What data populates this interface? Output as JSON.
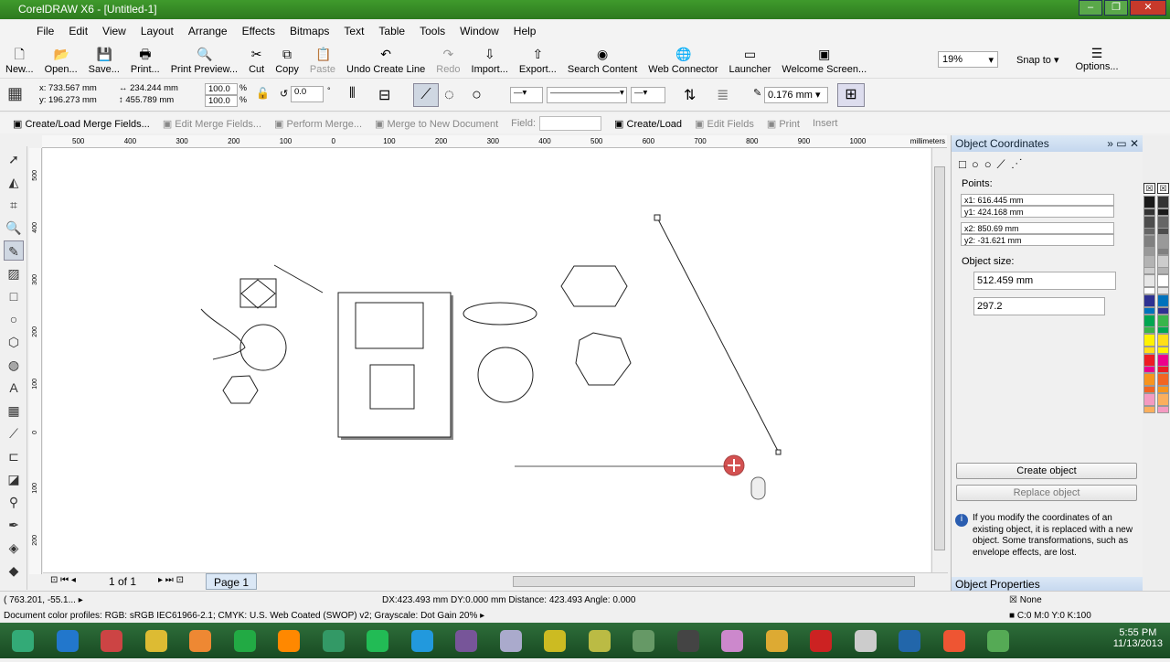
{
  "window": {
    "title": "CorelDRAW X6 - [Untitled-1]",
    "minimize": "–",
    "restore": "❐",
    "close": "✕"
  },
  "menu": [
    "File",
    "Edit",
    "View",
    "Layout",
    "Arrange",
    "Effects",
    "Bitmaps",
    "Text",
    "Table",
    "Tools",
    "Window",
    "Help"
  ],
  "toolbar": [
    {
      "label": "New...",
      "icon": "new-icon",
      "g": "🗋"
    },
    {
      "label": "Open...",
      "icon": "open-icon",
      "g": "📂"
    },
    {
      "label": "Save...",
      "icon": "save-icon",
      "g": "💾"
    },
    {
      "label": "Print...",
      "icon": "print-icon",
      "g": "🖶"
    },
    {
      "label": "Print Preview...",
      "icon": "print-preview-icon",
      "g": "🔍"
    },
    {
      "label": "Cut",
      "icon": "cut-icon",
      "g": "✂"
    },
    {
      "label": "Copy",
      "icon": "copy-icon",
      "g": "⧉"
    },
    {
      "label": "Paste",
      "icon": "paste-icon",
      "g": "📋",
      "disabled": true
    },
    {
      "label": "Undo Create Line",
      "icon": "undo-icon",
      "g": "↶"
    },
    {
      "label": "Redo",
      "icon": "redo-icon",
      "g": "↷",
      "disabled": true
    },
    {
      "label": "Import...",
      "icon": "import-icon",
      "g": "⇩"
    },
    {
      "label": "Export...",
      "icon": "export-icon",
      "g": "⇧"
    },
    {
      "label": "Search Content",
      "icon": "search-content-icon",
      "g": "◉"
    },
    {
      "label": "Web Connector",
      "icon": "globe-icon",
      "g": "🌐"
    },
    {
      "label": "Launcher",
      "icon": "launcher-icon",
      "g": "▭"
    },
    {
      "label": "Welcome Screen...",
      "icon": "welcome-icon",
      "g": "▣"
    }
  ],
  "zoom": "19%",
  "snap_to": "Snap to",
  "options": "Options...",
  "property": {
    "x": "x: 733.567 mm",
    "y": "y: 196.273 mm",
    "w": "234.244 mm",
    "h": "455.789 mm",
    "sx": "100.0",
    "sy": "100.0",
    "pct": "%",
    "angle": "0.0",
    "deg": "°",
    "outline": "0.176 mm"
  },
  "merge": {
    "create_load_fields": "Create/Load Merge Fields...",
    "edit_fields": "Edit Merge Fields...",
    "perform": "Perform Merge...",
    "to_new_doc": "Merge to New Document",
    "field_label": "Field:",
    "create_load": "Create/Load",
    "edit": "Edit Fields",
    "print": "Print",
    "insert": "Insert"
  },
  "ruler": {
    "top": [
      "500",
      "400",
      "300",
      "200",
      "100",
      "0",
      "100",
      "200",
      "300",
      "400",
      "500",
      "600",
      "700",
      "800",
      "900",
      "1000"
    ],
    "unit": "millimeters",
    "left": [
      "500",
      "400",
      "300",
      "200",
      "100",
      "0",
      "100",
      "200"
    ]
  },
  "nav": {
    "pages": "1 of 1",
    "page_tab": "Page 1"
  },
  "docker": {
    "title": "Object Coordinates",
    "points_label": "Points:",
    "x1": "616.445 mm",
    "y1": "424.168 mm",
    "x2": "850.69 mm",
    "y2": "-31.621 mm",
    "x1_l": "x1:",
    "y1_l": "y1:",
    "x2_l": "x2:",
    "y2_l": "y2:",
    "size_label": "Object size:",
    "length": "512.459 mm",
    "angle": "297.2",
    "create": "Create object",
    "replace": "Replace object",
    "info": "If you modify the coordinates of an existing object, it is replaced with a new object.  Some transformations, such as envelope effects, are lost.",
    "props_title": "Object Properties"
  },
  "status": {
    "cursor": "( 763.201, -55.1...",
    "measure": "DX:423.493 mm DY:0.000 mm Distance: 423.493 Angle: 0.000",
    "profiles": "Document color profiles: RGB: sRGB IEC61966-2.1; CMYK: U.S. Web Coated (SWOP) v2; Grayscale: Dot Gain 20%",
    "fill": "None",
    "outline": "C:0 M:0 Y:0 K:100"
  },
  "palette": [
    "#1a1a1a",
    "#333333",
    "#4d4d4d",
    "#666666",
    "#808080",
    "#999999",
    "#b3b3b3",
    "#cccccc",
    "#e6e6e6",
    "#ffffff",
    "#2e3192",
    "#0072bc",
    "#00a651",
    "#39b54a",
    "#fff200",
    "#ffde17",
    "#ed1c24",
    "#ec008c",
    "#f7941d",
    "#f26522",
    "#f49ac1",
    "#fbaf5d"
  ],
  "clock": {
    "time": "5:55 PM",
    "date": "11/13/2013"
  },
  "taskbar_apps": [
    "start",
    "ie",
    "tools",
    "explorer",
    "media",
    "chrome",
    "vlc",
    "network",
    "utorrent",
    "teamviewer",
    "vs",
    "box",
    "corel-v",
    "calc",
    "pen",
    "ball",
    "pinwheel",
    "pencil",
    "opera",
    "folder",
    "corel",
    "grid",
    "coreldraw"
  ]
}
